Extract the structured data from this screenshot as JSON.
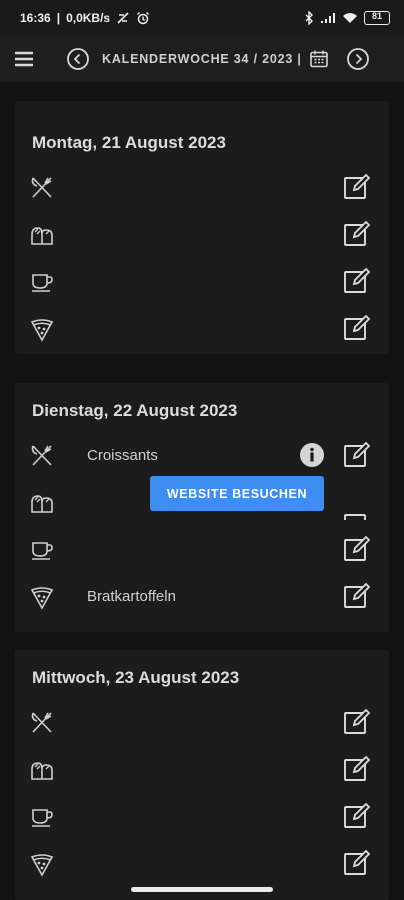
{
  "status_bar": {
    "time": "16:36",
    "network": "0,0KB/s",
    "battery": "81"
  },
  "app_bar": {
    "week_label": "KALENDERWOCHE 34 / 2023 |"
  },
  "days": [
    {
      "title": "Montag, 21 August 2023",
      "meals": [
        "",
        "",
        "",
        ""
      ]
    },
    {
      "title": "Dienstag, 22 August 2023",
      "meals": [
        "Croissants",
        "",
        "",
        "Bratkartoffeln"
      ]
    },
    {
      "title": "Mittwoch, 23 August 2023",
      "meals": [
        "",
        "",
        "",
        ""
      ]
    }
  ],
  "tooltip": {
    "label": "WEBSITE BESUCHEN"
  },
  "icons": {
    "menu": "menu-icon",
    "prev": "chevron-left-icon",
    "calendar": "calendar-icon",
    "next": "chevron-right-icon",
    "meal_types": [
      "cutlery-icon",
      "bread-icon",
      "coffee-cup-icon",
      "pizza-icon"
    ],
    "edit": "edit-icon",
    "info": "info-icon"
  },
  "colors": {
    "accent": "#3d8ef0",
    "background": "#121212",
    "card": "#1c1c1c"
  }
}
